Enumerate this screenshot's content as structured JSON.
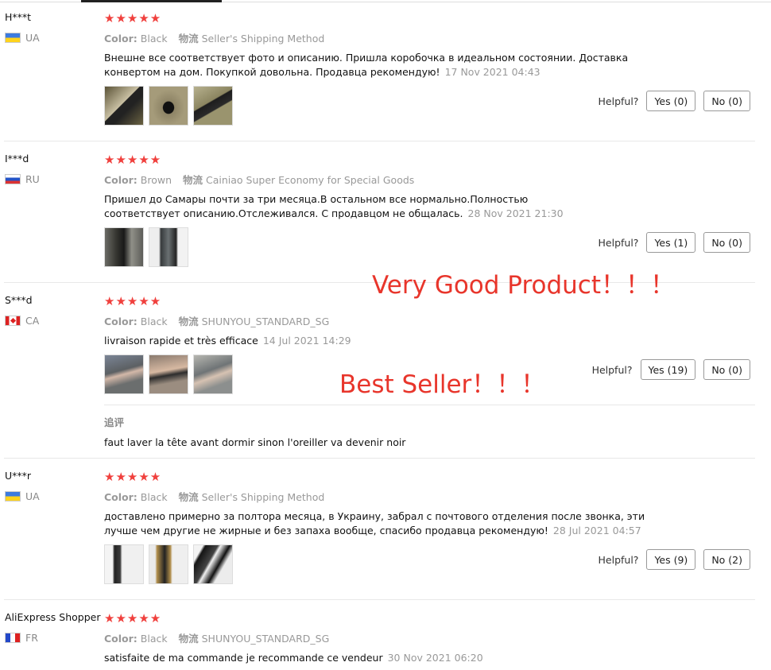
{
  "reviews": [
    {
      "user": "H***t",
      "country": "UA",
      "stars": "★★★★★",
      "color_label": "Color:",
      "color": "Black",
      "shipping_label": "物流",
      "shipping": "Seller's Shipping Method",
      "text": "Внешне все соответствует фото и описанию. Пришла коробочка в идеальном состоянии. Доставка конвертом на дом. Покупкой довольна. Продавца рекомендую!",
      "date": "17 Nov 2021 04:43",
      "helpful_label": "Helpful?",
      "yes": "Yes (0)",
      "no": "No (0)"
    },
    {
      "user": "I***d",
      "country": "RU",
      "stars": "★★★★★",
      "color_label": "Color:",
      "color": "Brown",
      "shipping_label": "物流",
      "shipping": "Cainiao Super Economy for Special Goods",
      "text": "Пришел до Самары почти за три месяца.В остальном все нормально.Полностью соответствует описанию.Отслеживался. С продавцом не общалась.",
      "date": "28 Nov 2021 21:30",
      "helpful_label": "Helpful?",
      "yes": "Yes (1)",
      "no": "No (0)"
    },
    {
      "user": "S***d",
      "country": "CA",
      "stars": "★★★★★",
      "color_label": "Color:",
      "color": "Black",
      "shipping_label": "物流",
      "shipping": "SHUNYOU_STANDARD_SG",
      "text": "livraison rapide et très efficace",
      "date": "14 Jul 2021 14:29",
      "helpful_label": "Helpful?",
      "yes": "Yes (19)",
      "no": "No (0)",
      "additional_label": "追评",
      "additional_text": "faut laver la tête avant dormir sinon l'oreiller va devenir noir"
    },
    {
      "user": "U***r",
      "country": "UA",
      "stars": "★★★★★",
      "color_label": "Color:",
      "color": "Black",
      "shipping_label": "物流",
      "shipping": "Seller's Shipping Method",
      "text": "доставлено примерно за полтора месяца, в Украину, забрал с почтового отделения после звонка, эти лучше чем другие не жирные и без запаха вообще, спасибо продавца рекомендую!",
      "date": "28 Jul 2021 04:57",
      "helpful_label": "Helpful?",
      "yes": "Yes (9)",
      "no": "No (2)"
    },
    {
      "user": "AliExpress Shopper",
      "country": "FR",
      "stars": "★★★★★",
      "color_label": "Color:",
      "color": "Black",
      "shipping_label": "物流",
      "shipping": "SHUNYOU_STANDARD_SG",
      "text": "satisfaite de ma commande je recommande ce vendeur",
      "date": "30 Nov 2021 06:20"
    }
  ],
  "overlay": {
    "line1": "Very Good Product！！！",
    "line2": "Best Seller！！！"
  },
  "colors": {
    "star": "#f0403d",
    "overlay_text": "#e8352b"
  }
}
